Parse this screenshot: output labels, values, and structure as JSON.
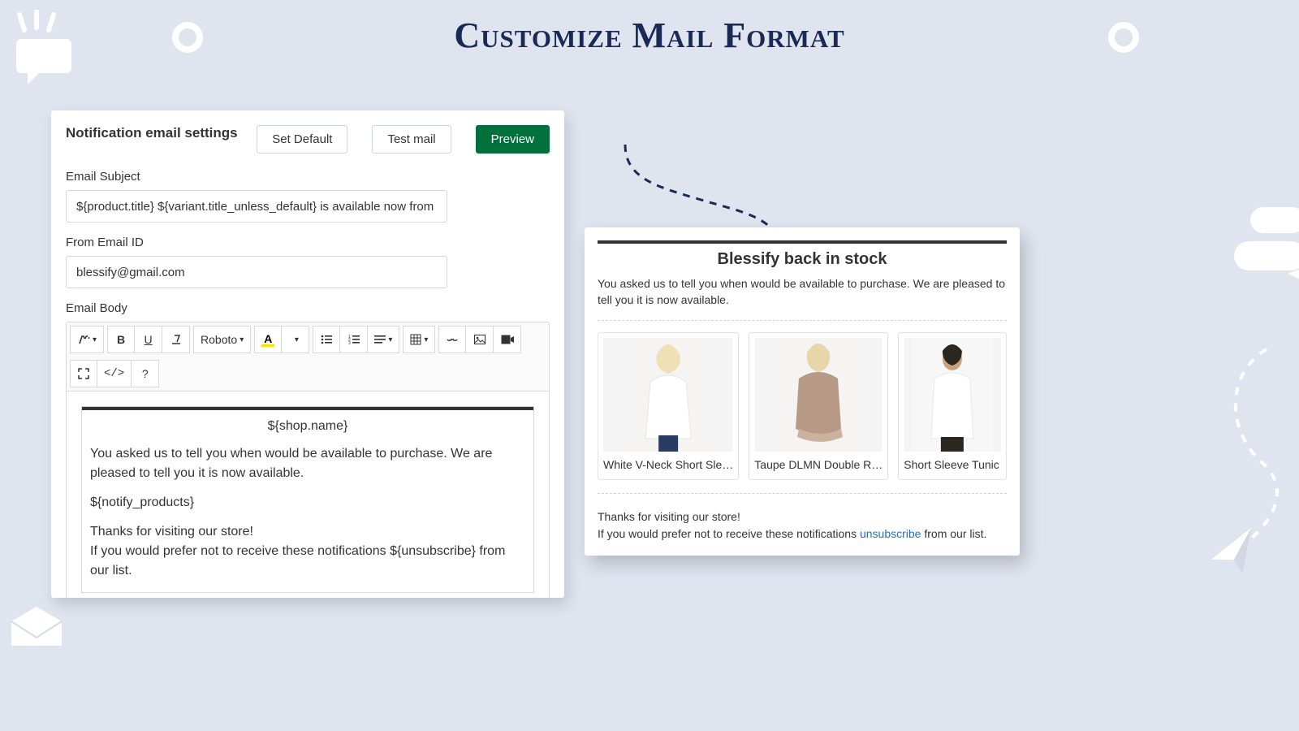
{
  "page": {
    "title": "Customize Mail Format"
  },
  "settings": {
    "panel_title": "Notification email settings",
    "buttons": {
      "set_default": "Set Default",
      "test_mail": "Test mail",
      "preview": "Preview"
    },
    "subject": {
      "label": "Email Subject",
      "value": "${product.title} ${variant.title_unless_default} is available now from ${sh"
    },
    "from": {
      "label": "From Email ID",
      "value": "blessify@gmail.com"
    },
    "body": {
      "label": "Email Body",
      "font_name": "Roboto",
      "template": {
        "shop_name": "${shop.name}",
        "intro": "You asked us to tell you when would be available to purchase. We are pleased to tell you it is now available.",
        "notify_products": "${notify_products}",
        "thanks": "Thanks for visiting our store!",
        "unsubscribe": "If you would prefer not to receive these notifications ${unsubscribe} from our list."
      }
    }
  },
  "preview": {
    "title": "Blessify back in stock",
    "intro": "You asked us to tell you when would be available to purchase. We are pleased to tell you it is now available.",
    "products": [
      {
        "name": "White V-Neck Short Sle…"
      },
      {
        "name": "Taupe DLMN Double R…"
      },
      {
        "name": "Short Sleeve Tunic"
      }
    ],
    "footer": {
      "thanks": "Thanks for visiting our store!",
      "prefix": "If you would prefer not to receive these notifications ",
      "link": "unsubscribe",
      "suffix": " from our list."
    }
  }
}
